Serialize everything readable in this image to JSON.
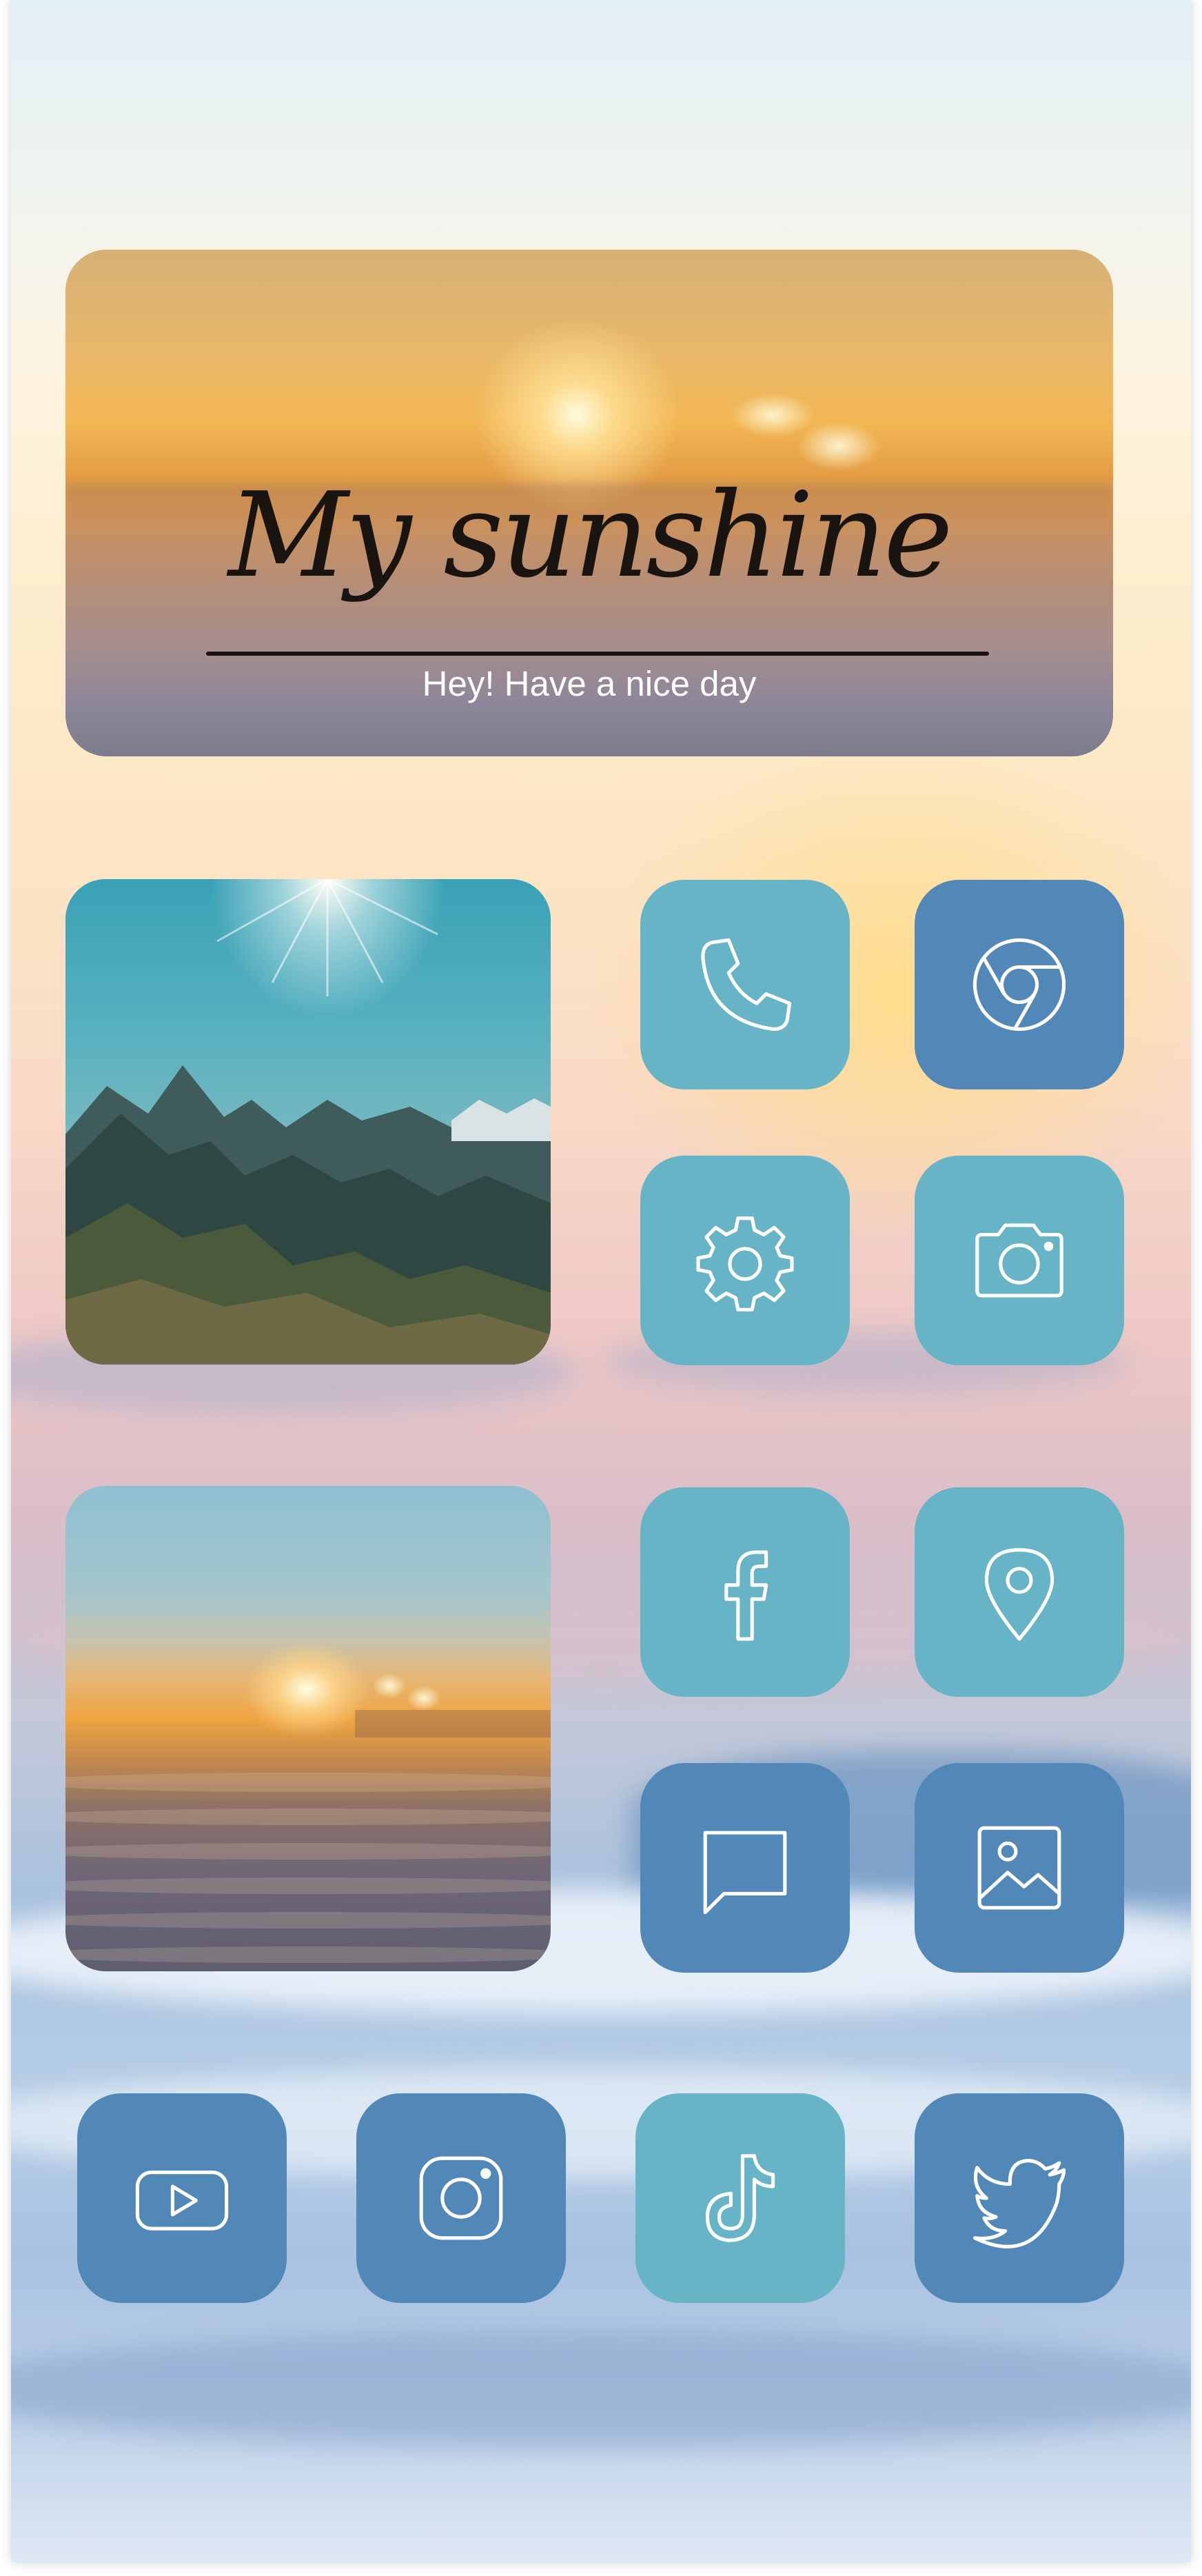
{
  "banner": {
    "title": "My sunshine",
    "subtitle": "Hey! Have a nice day"
  },
  "photos": [
    {
      "name": "mountain-photo",
      "subject": "sunlit mountains under a blue sky"
    },
    {
      "name": "sunset-photo",
      "subject": "sunset over a sea of clouds"
    }
  ],
  "apps": [
    {
      "name": "phone-app",
      "icon": "phone-icon",
      "color": "#66b4c6"
    },
    {
      "name": "chrome-app",
      "icon": "chrome-icon",
      "color": "#5188b8"
    },
    {
      "name": "settings-app",
      "icon": "gear-icon",
      "color": "#66b4c6"
    },
    {
      "name": "camera-app",
      "icon": "camera-icon",
      "color": "#66b4c6"
    },
    {
      "name": "facebook-app",
      "icon": "facebook-icon",
      "color": "#66b4c6"
    },
    {
      "name": "maps-app",
      "icon": "location-pin-icon",
      "color": "#66b4c6"
    },
    {
      "name": "messages-app",
      "icon": "chat-bubble-icon",
      "color": "#5188b8"
    },
    {
      "name": "gallery-app",
      "icon": "image-icon",
      "color": "#5188b8"
    },
    {
      "name": "youtube-app",
      "icon": "youtube-icon",
      "color": "#5188b8"
    },
    {
      "name": "instagram-app",
      "icon": "instagram-icon",
      "color": "#5188b8"
    },
    {
      "name": "tiktok-app",
      "icon": "tiktok-icon",
      "color": "#66b4c6"
    },
    {
      "name": "twitter-app",
      "icon": "twitter-icon",
      "color": "#5188b8"
    }
  ],
  "colors": {
    "teal_tile": "#66b4c6",
    "blue_tile": "#5188b8",
    "icon_stroke": "#ffffff"
  }
}
